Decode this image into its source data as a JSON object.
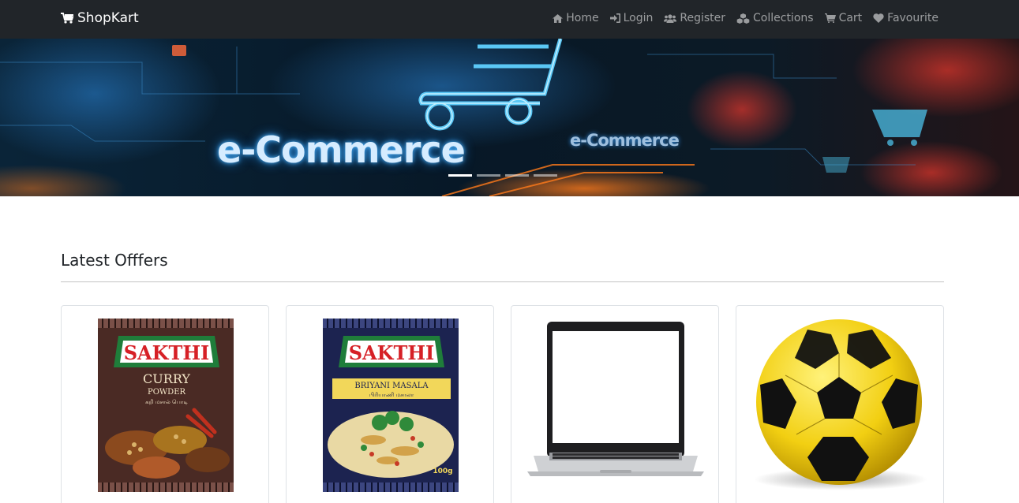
{
  "navbar": {
    "brand": "ShopKart",
    "items": [
      {
        "label": "Home",
        "icon": "home-icon"
      },
      {
        "label": "Login",
        "icon": "sign-in-icon"
      },
      {
        "label": "Register",
        "icon": "users-icon"
      },
      {
        "label": "Collections",
        "icon": "cubes-icon"
      },
      {
        "label": "Cart",
        "icon": "cart-icon"
      },
      {
        "label": "Favourite",
        "icon": "heart-icon"
      }
    ]
  },
  "carousel": {
    "banner_text": "e-Commerce",
    "banner_text_secondary": "e-Commerce",
    "slide_count": 4,
    "active_slide": 1
  },
  "section": {
    "title": "Latest Offfers"
  },
  "products": [
    {
      "image": "sakthi-curry-powder-pack",
      "brand": "SAKTHI",
      "name": "CURRY",
      "sub": "POWDER",
      "tamil": "கறி மசால் பொடி"
    },
    {
      "image": "sakthi-briyani-masala-pack",
      "brand": "SAKTHI",
      "name": "BRIYANI MASALA",
      "tamil": "பிரியாணி மசாலா",
      "weight": "100g"
    },
    {
      "image": "laptop"
    },
    {
      "image": "football-yellow-black"
    }
  ],
  "colors": {
    "navbar_bg": "#212529",
    "nav_text": "#8c8f92",
    "brand_text": "#ffffff"
  }
}
